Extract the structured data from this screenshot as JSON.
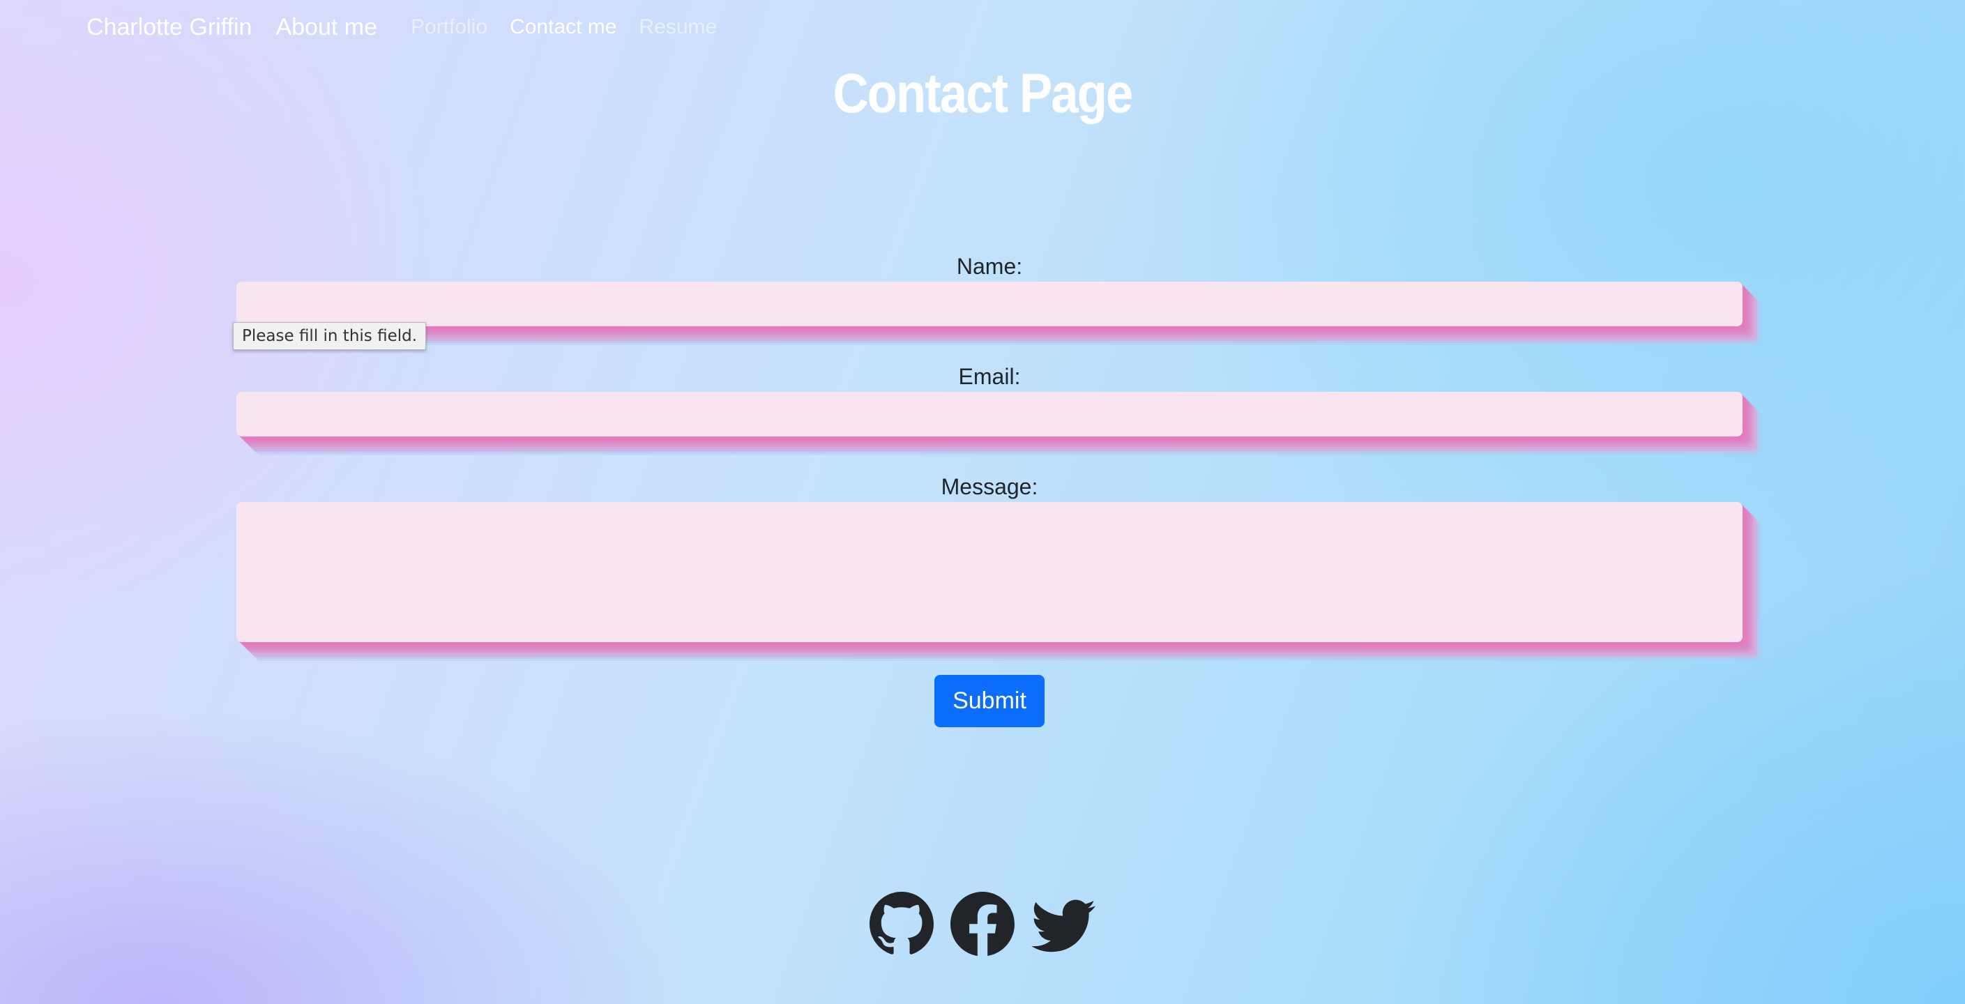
{
  "nav": {
    "brand": "Charlotte Griffin",
    "about": "About me",
    "links": [
      {
        "label": "Portfolio",
        "active": false
      },
      {
        "label": "Contact me",
        "active": true
      },
      {
        "label": "Resume",
        "active": false
      }
    ]
  },
  "page": {
    "title": "Contact Page"
  },
  "form": {
    "name_label": "Name:",
    "name_value": "",
    "email_label": "Email:",
    "email_value": "",
    "message_label": "Message:",
    "message_value": "",
    "validation_tooltip": "Please fill in this field.",
    "submit_label": "Submit"
  },
  "social": {
    "icons": [
      "github-icon",
      "facebook-icon",
      "twitter-icon"
    ]
  },
  "colors": {
    "field_background": "#f9e5ef",
    "field_shadow": "#e879bc",
    "submit_button": "#0d6efd",
    "icon": "#212529"
  }
}
